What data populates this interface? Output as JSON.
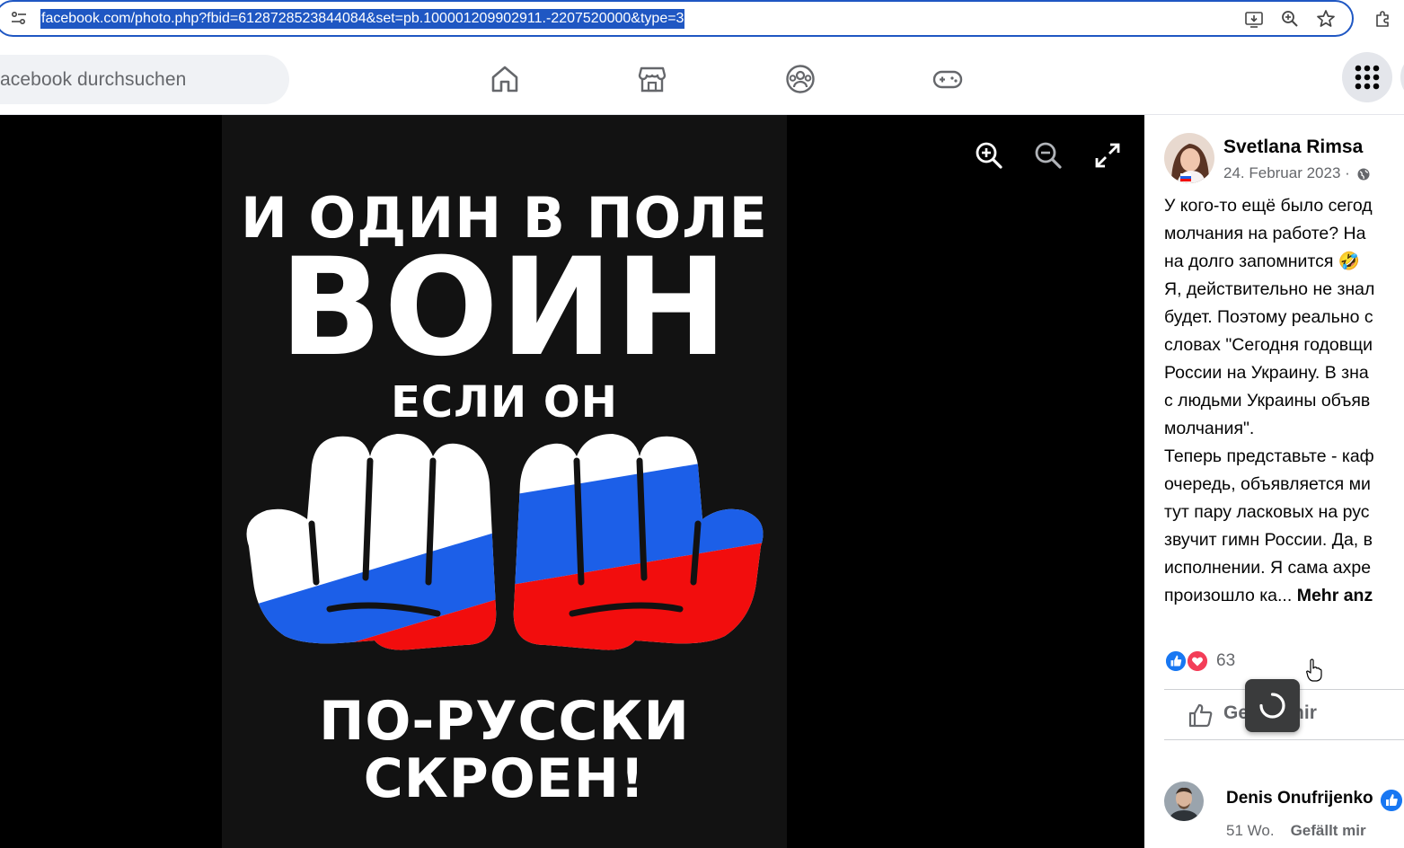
{
  "browser": {
    "url": "facebook.com/photo.php?fbid=6128728523844084&set=pb.100001209902911.-2207520000&type=3"
  },
  "fbnav": {
    "search_placeholder": "acebook durchsuchen"
  },
  "photo": {
    "line1": "И ОДИН В ПОЛЕ",
    "line2": "ВОИН",
    "line3": "ЕСЛИ ОН",
    "line4": "ПО-РУССКИ",
    "line5": "СКРОЕН!"
  },
  "colors": {
    "accent": "#1877f2",
    "url_highlight": "#1f57c3",
    "flag_blue": "#1c5fe8",
    "flag_red": "#f20d0d"
  },
  "post": {
    "author": "Svetlana Rimsa",
    "date": "24. Februar 2023 ·",
    "lines": [
      "У кого-то ещё было сегод",
      "молчания на работе? На",
      "на долго запомнится 🤣",
      "Я, действительно не знал",
      "будет. Поэтому реально с",
      "словах \"Сегодня годовщи",
      "России на Украину. В зна",
      "с людьми Украины объяв",
      "молчания\".",
      "Теперь представьте - каф",
      "очередь, объявляется ми",
      "тут пару ласковых на рус",
      "звучит гимн России. Да, в",
      "исполнении. Я сама ахре"
    ],
    "last_line": "произошло ка...",
    "more_label": "Mehr anz",
    "reaction_count": "63",
    "like_label": "Gefällt mir"
  },
  "comment": {
    "author": "Denis Onufrijenko",
    "time": "51 Wo.",
    "like_label": "Gefällt mir"
  }
}
